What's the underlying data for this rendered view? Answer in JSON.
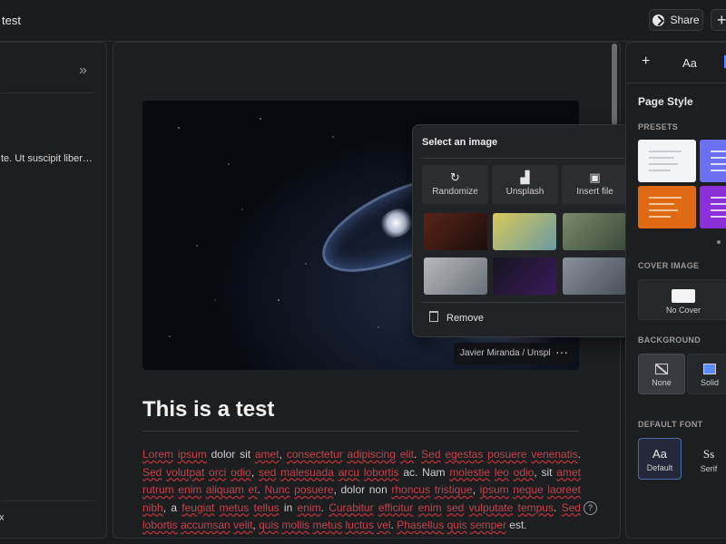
{
  "header": {
    "doc_title": "test",
    "share_label": "Share",
    "plus_label": "+"
  },
  "left_panel": {
    "collapse_label": "»",
    "snippet": "te. Ut suscipit liber…",
    "bottom_label": "x"
  },
  "cover": {
    "credit": "Javier Miranda / Unsplash",
    "more_label": "···"
  },
  "document": {
    "heading": "This is a test",
    "body_segments": [
      {
        "t": "Lorem",
        "s": true
      },
      {
        "t": " "
      },
      {
        "t": "ipsum",
        "s": true
      },
      {
        "t": " dolor sit "
      },
      {
        "t": "amet",
        "s": true
      },
      {
        "t": ", "
      },
      {
        "t": "consectetur",
        "s": true
      },
      {
        "t": " "
      },
      {
        "t": "adipiscing",
        "s": true
      },
      {
        "t": " "
      },
      {
        "t": "elit",
        "s": true
      },
      {
        "t": ". "
      },
      {
        "t": "Sed",
        "s": true
      },
      {
        "t": " "
      },
      {
        "t": "egestas",
        "s": true
      },
      {
        "t": " "
      },
      {
        "t": "posuere",
        "s": true
      },
      {
        "t": " "
      },
      {
        "t": "venenatis",
        "s": true
      },
      {
        "t": ". "
      },
      {
        "t": "Sed",
        "s": true
      },
      {
        "t": " "
      },
      {
        "t": "volutpat",
        "s": true
      },
      {
        "t": " "
      },
      {
        "t": "orci",
        "s": true
      },
      {
        "t": " "
      },
      {
        "t": "odio",
        "s": true
      },
      {
        "t": ", "
      },
      {
        "t": "sed",
        "s": true
      },
      {
        "t": " "
      },
      {
        "t": "malesuada",
        "s": true
      },
      {
        "t": " "
      },
      {
        "t": "arcu",
        "s": true
      },
      {
        "t": " "
      },
      {
        "t": "lobortis",
        "s": true
      },
      {
        "t": " ac. Nam "
      },
      {
        "t": "molestie",
        "s": true
      },
      {
        "t": " "
      },
      {
        "t": "leo",
        "s": true
      },
      {
        "t": " "
      },
      {
        "t": "odio",
        "s": true
      },
      {
        "t": ", sit "
      },
      {
        "t": "amet",
        "s": true
      },
      {
        "t": " "
      },
      {
        "t": "rutrum",
        "s": true
      },
      {
        "t": " "
      },
      {
        "t": "enim",
        "s": true
      },
      {
        "t": " "
      },
      {
        "t": "aliquam",
        "s": true
      },
      {
        "t": " "
      },
      {
        "t": "et",
        "s": true
      },
      {
        "t": ". "
      },
      {
        "t": "Nunc",
        "s": true
      },
      {
        "t": " "
      },
      {
        "t": "posuere",
        "s": true
      },
      {
        "t": ", dolor non "
      },
      {
        "t": "rhoncus",
        "s": true
      },
      {
        "t": " "
      },
      {
        "t": "tristique",
        "s": true
      },
      {
        "t": ", "
      },
      {
        "t": "ipsum",
        "s": true
      },
      {
        "t": " "
      },
      {
        "t": "neque",
        "s": true
      },
      {
        "t": " "
      },
      {
        "t": "laoreet",
        "s": true
      },
      {
        "t": " "
      },
      {
        "t": "nibh",
        "s": true
      },
      {
        "t": ", a "
      },
      {
        "t": "feugiat",
        "s": true
      },
      {
        "t": " "
      },
      {
        "t": "metus",
        "s": true
      },
      {
        "t": " "
      },
      {
        "t": "tellus",
        "s": true
      },
      {
        "t": " in "
      },
      {
        "t": "enim",
        "s": true
      },
      {
        "t": ". "
      },
      {
        "t": "Curabitur",
        "s": true
      },
      {
        "t": " "
      },
      {
        "t": "efficitur",
        "s": true
      },
      {
        "t": " "
      },
      {
        "t": "enim",
        "s": true
      },
      {
        "t": " "
      },
      {
        "t": "sed",
        "s": true
      },
      {
        "t": " "
      },
      {
        "t": "vulputate",
        "s": true
      },
      {
        "t": " "
      },
      {
        "t": "tempus",
        "s": true
      },
      {
        "t": ". "
      },
      {
        "t": "Sed",
        "s": true
      },
      {
        "t": " "
      },
      {
        "t": "lobortis",
        "s": true
      },
      {
        "t": " "
      },
      {
        "t": "accumsan",
        "s": true
      },
      {
        "t": " "
      },
      {
        "t": "velit",
        "s": true
      },
      {
        "t": ", "
      },
      {
        "t": "quis",
        "s": true
      },
      {
        "t": " "
      },
      {
        "t": "mollis",
        "s": true
      },
      {
        "t": " "
      },
      {
        "t": "metus",
        "s": true
      },
      {
        "t": " "
      },
      {
        "t": "luctus",
        "s": true
      },
      {
        "t": " "
      },
      {
        "t": "vel",
        "s": true
      },
      {
        "t": ". "
      },
      {
        "t": "Phasellus",
        "s": true
      },
      {
        "t": " "
      },
      {
        "t": "quis",
        "s": true
      },
      {
        "t": " "
      },
      {
        "t": "semper",
        "s": true
      },
      {
        "t": " est."
      }
    ],
    "help_label": "?"
  },
  "image_popup": {
    "title": "Select an image",
    "actions": [
      {
        "label": "Randomize",
        "icon": "refresh-icon",
        "glyph": "↻"
      },
      {
        "label": "Unsplash",
        "icon": "unsplash-icon",
        "glyph": "▟"
      },
      {
        "label": "Insert file",
        "icon": "image-icon",
        "glyph": "▣"
      }
    ],
    "thumbnails": [
      {
        "name": "thumb-person-reading",
        "c1": "#5a2418",
        "c2": "#1a0e0a"
      },
      {
        "name": "thumb-colorful-bottles",
        "c1": "#d9c95a",
        "c2": "#6a9aa0"
      },
      {
        "name": "thumb-lab-workers",
        "c1": "#7a8a6a",
        "c2": "#3a4a3a"
      },
      {
        "name": "thumb-microscope",
        "c1": "#b8b8bc",
        "c2": "#6a7078"
      },
      {
        "name": "thumb-neon-cells",
        "c1": "#151520",
        "c2": "#3a1a5a"
      },
      {
        "name": "thumb-lab-shelves",
        "c1": "#8a9098",
        "c2": "#4a5058"
      }
    ],
    "remove_label": "Remove"
  },
  "right_panel": {
    "tab_plus": "+",
    "tab_text": "Aa",
    "section_title": "Page Style",
    "presets_label": "PRESETS",
    "presets": [
      {
        "bg": "#f3f4f6",
        "line": "#c9ccd3"
      },
      {
        "bg": "#6b6ff0",
        "line": "#dfe2f5"
      },
      {
        "bg": "#e06a14",
        "line": "#f3c79b"
      },
      {
        "bg": "#8b2fd9",
        "line": "#e3d0f5"
      }
    ],
    "cover_label": "COVER IMAGE",
    "cover_option": "No Cover",
    "background_label": "BACKGROUND",
    "background_options": [
      "None",
      "Solid"
    ],
    "font_label": "DEFAULT FONT",
    "font_options": [
      {
        "glyph": "Aa",
        "label": "Default"
      },
      {
        "glyph": "Ss",
        "label": "Serif"
      }
    ],
    "accent_color": "#5b8cff"
  }
}
